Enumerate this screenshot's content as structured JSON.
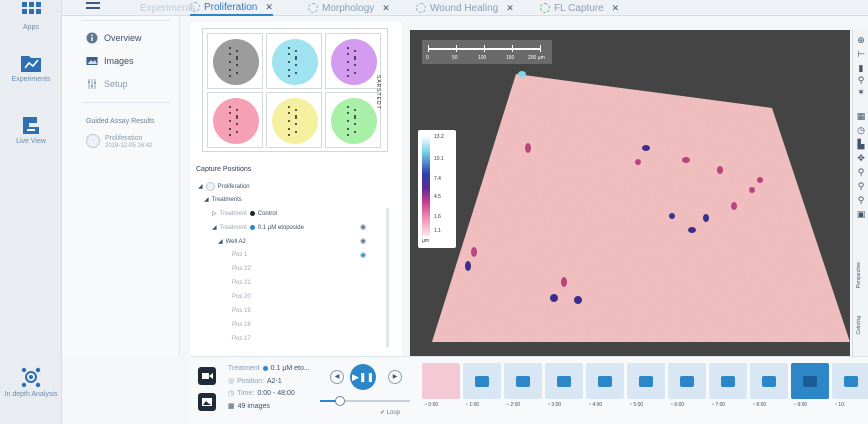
{
  "rail": {
    "items": [
      {
        "label": "Apps",
        "icon": "grid-icon"
      },
      {
        "label": "Experiments",
        "icon": "chart-folder-icon"
      },
      {
        "label": "Live View",
        "icon": "microscope-icon"
      },
      {
        "label": "In depth Analysis",
        "icon": "network-analysis-icon"
      }
    ]
  },
  "tabs": [
    {
      "label": "Experiments"
    },
    {
      "label": "Proliferation",
      "active": true
    },
    {
      "label": "Morphology"
    },
    {
      "label": "Wound Healing"
    },
    {
      "label": "FL Capture"
    }
  ],
  "nav": {
    "items": [
      {
        "label": "Overview",
        "icon": "info-icon"
      },
      {
        "label": "Images",
        "icon": "images-icon"
      },
      {
        "label": "Setup",
        "icon": "sliders-icon"
      }
    ],
    "guided_title": "Guided Assay Results",
    "assay_name": "Proliferation",
    "assay_date": "2019-12-05 16:42"
  },
  "plate": {
    "label": "SARSTEDT",
    "wells": [
      {
        "color": "#9c9c9c"
      },
      {
        "color": "#9fe3f0"
      },
      {
        "color": "#d39cf0"
      },
      {
        "color": "#f5a0b4"
      },
      {
        "color": "#f5f0a0"
      },
      {
        "color": "#a8f0a8"
      }
    ]
  },
  "capture": {
    "title": "Capture Positions",
    "rows": [
      {
        "label": "Proliferation"
      },
      {
        "label": "Treatments"
      },
      {
        "prefix": "Treatment",
        "label": "Control"
      },
      {
        "prefix": "Treatment",
        "label": "0.1 μM etoposide"
      },
      {
        "label": "Well A2"
      },
      {
        "label": "Pos 1"
      },
      {
        "label": "Pos 22"
      },
      {
        "label": "Pos 21"
      },
      {
        "label": "Pos 20"
      },
      {
        "label": "Pos 19"
      },
      {
        "label": "Pos 18"
      },
      {
        "label": "Pos 17"
      }
    ]
  },
  "viewer": {
    "scale_labels": [
      "0",
      "50",
      "100",
      "150",
      "200 µm"
    ],
    "lut_labels": [
      "13.2",
      "10.1",
      "7.4",
      "4.5",
      "1.6",
      "1.1",
      "µm"
    ]
  },
  "right_toolbar": {
    "icons": [
      "plus-icon",
      "minus-icon",
      "ruler-icon",
      "pin-icon",
      "bulb-icon",
      "settings-grid-icon",
      "timer-icon",
      "histogram-icon",
      "pointer-icon",
      "zoom-in-icon",
      "zoom-out-icon",
      "zoom-fit-icon",
      "save-icon"
    ],
    "perspective_label": "Perspective",
    "coloring_label": "Coloring"
  },
  "bottom": {
    "treatment_label": "Treatment",
    "treatment_value": "0.1 μM eto...",
    "position_label": "Position:",
    "position_value": "A2-1",
    "time_label": "Time:",
    "time_value": "0:00 - 48:00",
    "images_value": "49 images",
    "loop_label": "Loop",
    "slider_progress": 0.22,
    "timeline": [
      "0:00",
      "1:00",
      "2:00",
      "3:00",
      "4:00",
      "5:00",
      "6:00",
      "7:00",
      "8:00",
      "9:00",
      "10:"
    ],
    "selected_index": 9
  }
}
